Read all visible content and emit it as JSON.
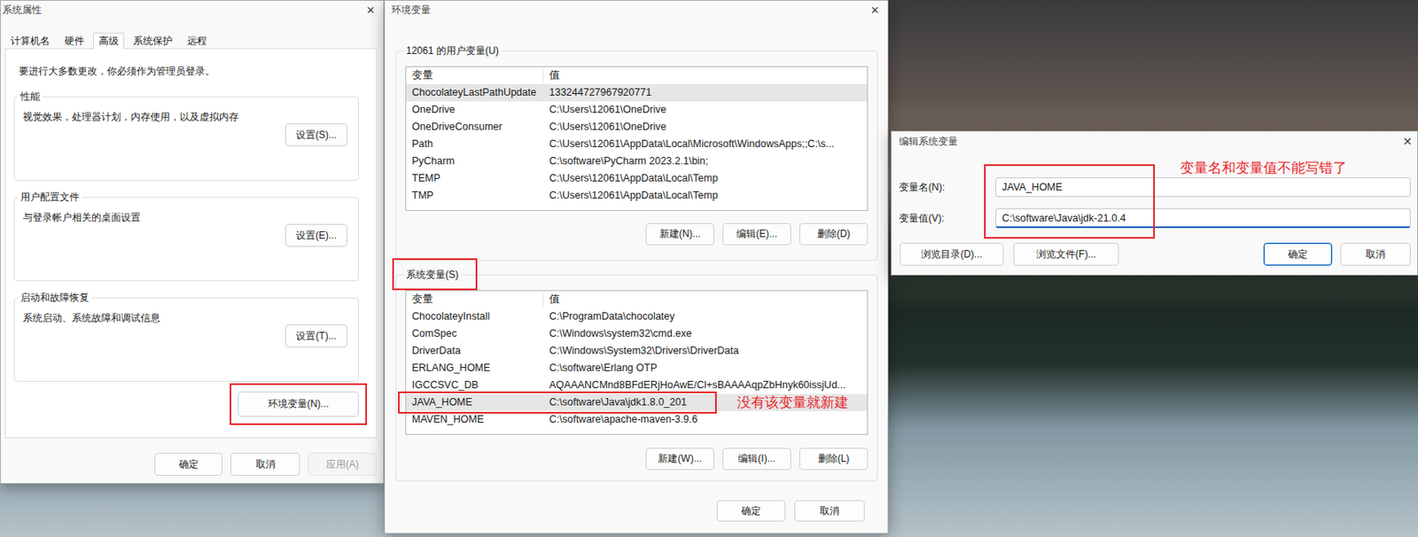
{
  "system_properties": {
    "title": "系统属性",
    "close": "✕",
    "tabs": [
      {
        "label": "计算机名",
        "selected": false
      },
      {
        "label": "硬件",
        "selected": false
      },
      {
        "label": "高级",
        "selected": true
      },
      {
        "label": "系统保护",
        "selected": false
      },
      {
        "label": "远程",
        "selected": false
      }
    ],
    "notice": "要进行大多数更改，你必须作为管理员登录。",
    "groups": [
      {
        "label": "性能",
        "text": "视觉效果，处理器计划，内存使用，以及虚拟内存",
        "button": "设置(S)..."
      },
      {
        "label": "用户配置文件",
        "text": "与登录帐户相关的桌面设置",
        "button": "设置(E)..."
      },
      {
        "label": "启动和故障恢复",
        "text": "系统启动、系统故障和调试信息",
        "button": "设置(T)..."
      }
    ],
    "env_button": "环境变量(N)...",
    "buttons": [
      {
        "label": "确定",
        "disabled": false
      },
      {
        "label": "取消",
        "disabled": false
      },
      {
        "label": "应用(A)",
        "disabled": true
      }
    ]
  },
  "environment_variables": {
    "title": "环境变量",
    "close": "✕",
    "sections": [
      {
        "label": "12061 的用户变量(U)",
        "columns": [
          "变量",
          "值"
        ],
        "rows": [
          {
            "name": "ChocolateyLastPathUpdate",
            "value": "133244727967920771",
            "selected": true
          },
          {
            "name": "OneDrive",
            "value": "C:\\Users\\12061\\OneDrive",
            "selected": false
          },
          {
            "name": "OneDriveConsumer",
            "value": "C:\\Users\\12061\\OneDrive",
            "selected": false
          },
          {
            "name": "Path",
            "value": "C:\\Users\\12061\\AppData\\Local\\Microsoft\\WindowsApps;;C:\\s...",
            "selected": false
          },
          {
            "name": "PyCharm",
            "value": "C:\\software\\PyCharm 2023.2.1\\bin;",
            "selected": false
          },
          {
            "name": "TEMP",
            "value": "C:\\Users\\12061\\AppData\\Local\\Temp",
            "selected": false
          },
          {
            "name": "TMP",
            "value": "C:\\Users\\12061\\AppData\\Local\\Temp",
            "selected": false
          }
        ],
        "buttons": [
          "新建(N)...",
          "编辑(E)...",
          "删除(D)"
        ]
      },
      {
        "label": "系统变量(S)",
        "columns": [
          "变量",
          "值"
        ],
        "rows": [
          {
            "name": "ChocolateyInstall",
            "value": "C:\\ProgramData\\chocolatey",
            "selected": false
          },
          {
            "name": "ComSpec",
            "value": "C:\\Windows\\system32\\cmd.exe",
            "selected": false
          },
          {
            "name": "DriverData",
            "value": "C:\\Windows\\System32\\Drivers\\DriverData",
            "selected": false
          },
          {
            "name": "ERLANG_HOME",
            "value": "C:\\software\\Erlang OTP",
            "selected": false
          },
          {
            "name": "IGCCSVC_DB",
            "value": "AQAAANCMnd8BFdERjHoAwE/Cl+sBAAAAqpZbHnyk60issjUd...",
            "selected": false
          },
          {
            "name": "JAVA_HOME",
            "value": "C:\\software\\Java\\jdk1.8.0_201",
            "selected": true
          },
          {
            "name": "MAVEN_HOME",
            "value": "C:\\software\\apache-maven-3.9.6",
            "selected": false
          }
        ],
        "buttons": [
          "新建(W)...",
          "编辑(I)...",
          "删除(L)"
        ]
      }
    ],
    "buttons": [
      "确定",
      "取消"
    ]
  },
  "edit_variable": {
    "title": "编辑系统变量",
    "close": "✕",
    "fields": [
      {
        "label": "变量名(N):",
        "value": "JAVA_HOME",
        "focused": false
      },
      {
        "label": "变量值(V):",
        "value": "C:\\software\\Java\\jdk-21.0.4",
        "focused": true
      }
    ],
    "browse_buttons": [
      "浏览目录(D)...",
      "浏览文件(F)..."
    ],
    "buttons": [
      {
        "label": "确定",
        "default": true
      },
      {
        "label": "取消",
        "default": false
      }
    ]
  },
  "annotations": [
    {
      "text": "没有该变量就新建"
    },
    {
      "text": "变量名和变量值不能写错了"
    }
  ]
}
